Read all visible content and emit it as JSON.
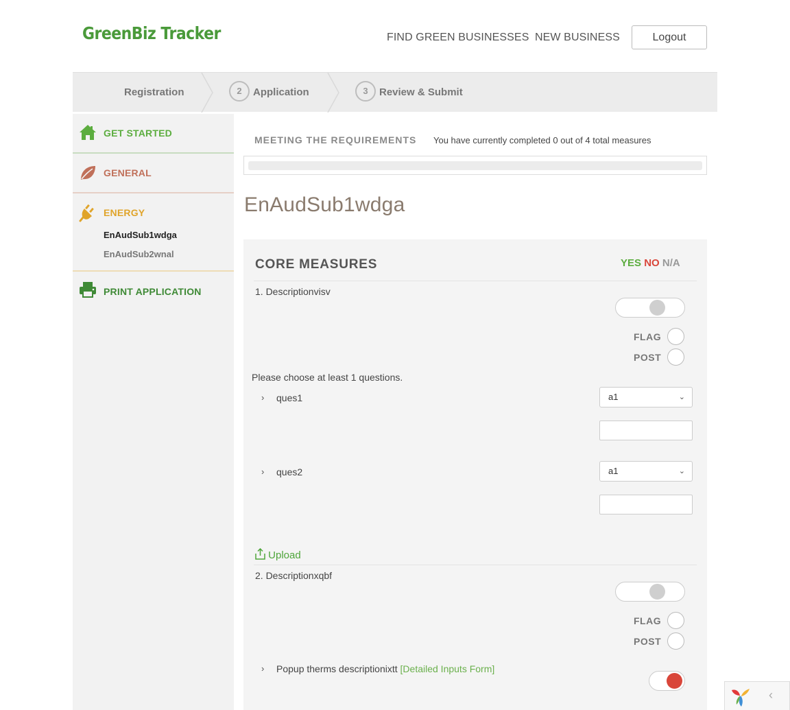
{
  "header": {
    "logo": "GreenBiz Tracker",
    "nav": [
      "FIND GREEN BUSINESSES",
      "NEW BUSINESS"
    ],
    "logout": "Logout"
  },
  "steps": [
    {
      "num": "",
      "label": "Registration"
    },
    {
      "num": "2",
      "label": "Application"
    },
    {
      "num": "3",
      "label": "Review & Submit"
    }
  ],
  "sidebar": {
    "get_started": "GET STARTED",
    "general": "GENERAL",
    "energy": "ENERGY",
    "energy_items": [
      "EnAudSub1wdga",
      "EnAudSub2wnal"
    ],
    "print": "PRINT APPLICATION",
    "colors": {
      "get_started": "#5cad3f",
      "general": "#c0705a",
      "energy": "#e0a42a",
      "print": "#3f8a36"
    }
  },
  "requirements": {
    "title": "MEETING THE REQUIREMENTS",
    "text": "You have currently completed 0 out of 4 total measures",
    "completed": 0,
    "total": 4
  },
  "page_title": "EnAudSub1wdga",
  "core": {
    "title": "CORE MEASURES",
    "legend": {
      "yes": "YES",
      "no": "NO",
      "na": "N/A"
    },
    "flag_label": "FLAG",
    "post_label": "POST",
    "measure1": {
      "desc": "1. Descriptionvisv",
      "hint": "Please choose at least 1 questions.",
      "questions": [
        {
          "label": "ques1",
          "selected": "a1"
        },
        {
          "label": "ques2",
          "selected": "a1"
        }
      ],
      "upload": "Upload"
    },
    "measure2": {
      "desc": "2. Descriptionxqbf",
      "popup_label": "Popup therms descriptionixtt",
      "popup_link": "[Detailed Inputs Form]"
    }
  },
  "icons": {
    "caret": "›",
    "chevron_down": "⌄",
    "collapse": "‹"
  }
}
